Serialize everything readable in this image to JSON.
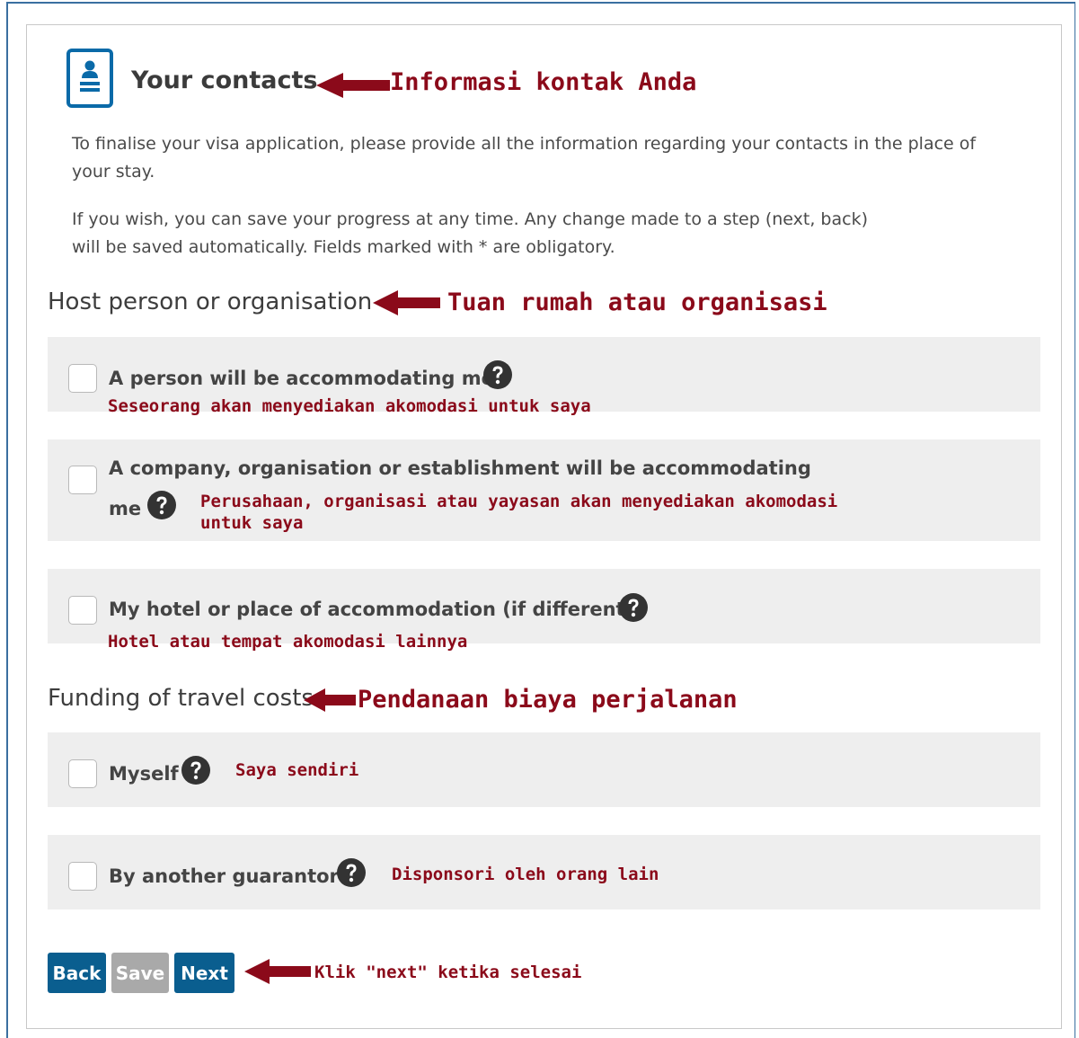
{
  "header": {
    "title": "Your contacts",
    "annotation": "Informasi kontak Anda"
  },
  "intro": {
    "paragraph1_line1": "To finalise your visa application, please provide all the information regarding your contacts in the place of",
    "paragraph1_line2": "your stay.",
    "paragraph2_line1": "If you wish, you can save your progress at any time. Any change made to a step (next, back)",
    "paragraph2_line2": "will be saved automatically. Fields marked with * are obligatory."
  },
  "host_section": {
    "heading": "Host person or organisation",
    "annotation": "Tuan rumah atau organisasi",
    "options": [
      {
        "label": "A person will be accommodating me",
        "annotation": "Seseorang akan menyediakan akomodasi untuk saya",
        "checked": false
      },
      {
        "label_line1": "A company, organisation or establishment will be accommodating",
        "label_line2": "me",
        "annotation_line1": "Perusahaan, organisasi atau yayasan akan menyediakan akomodasi",
        "annotation_line2": "untuk saya",
        "checked": false
      },
      {
        "label": "My hotel or place of accommodation (if different)",
        "annotation": "Hotel atau tempat akomodasi lainnya",
        "checked": false
      }
    ]
  },
  "funding_section": {
    "heading": "Funding of travel costs",
    "annotation": "Pendanaan biaya perjalanan",
    "options": [
      {
        "label": "Myself",
        "annotation": "Saya sendiri",
        "checked": false
      },
      {
        "label": "By another guarantor",
        "annotation": "Disponsori oleh orang lain",
        "checked": false
      }
    ]
  },
  "buttons": {
    "back": "Back",
    "save": "Save",
    "next": "Next",
    "annotation": "Klik \"next\" ketika selesai"
  },
  "colors": {
    "primary_button": "#0a5e8f",
    "disabled_button": "#a9a9a9",
    "annotation": "#8b0a1a",
    "panel_background": "#eeeeee",
    "icon_blue": "#0a6aa8"
  },
  "icons": {
    "header_icon": "contact-card-icon",
    "help_icon": "question-circle-icon",
    "annotation_arrow": "arrow-left-icon"
  }
}
